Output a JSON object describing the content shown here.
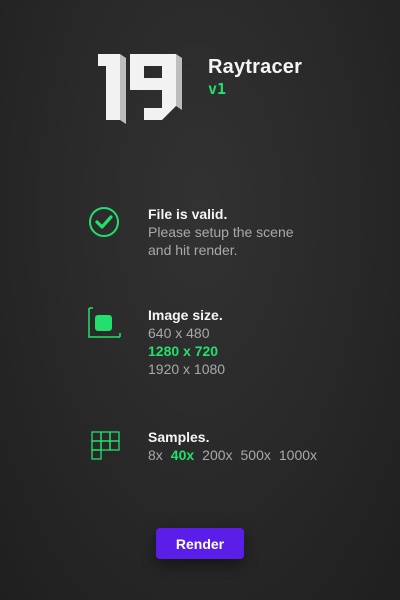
{
  "app": {
    "title": "Raytracer",
    "version": "v1",
    "logo_icon": "logo-19-mark"
  },
  "colors": {
    "accent_green": "#22e06b",
    "button_purple": "#5a1ee8",
    "muted_text": "#a9a9a9"
  },
  "file_status": {
    "icon": "check-circle-icon",
    "heading": "File is valid.",
    "line1": "Please setup the scene",
    "line2": "and hit render."
  },
  "image_size": {
    "icon": "image-frame-icon",
    "heading": "Image size.",
    "options": [
      "640 x 480",
      "1280 x 720",
      "1920 x 1080"
    ],
    "selected": "1280 x 720"
  },
  "samples": {
    "icon": "grid-icon",
    "heading": "Samples.",
    "options": [
      "8x",
      "40x",
      "200x",
      "500x",
      "1000x"
    ],
    "selected": "40x"
  },
  "render_button": {
    "label": "Render"
  }
}
